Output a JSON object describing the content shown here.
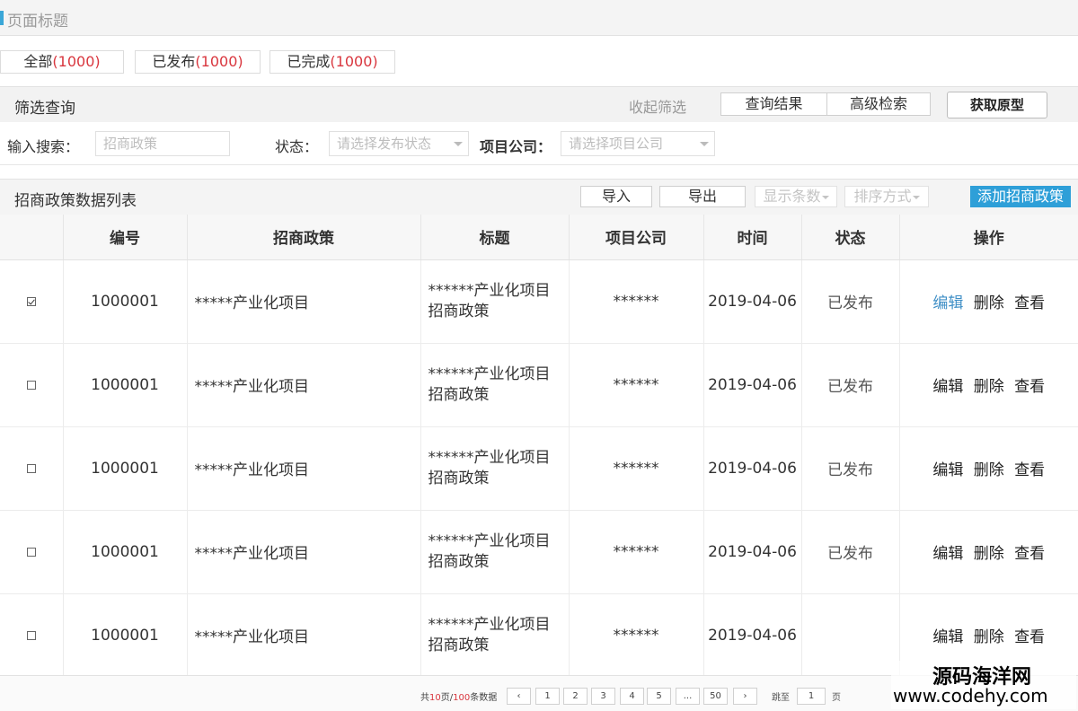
{
  "page": {
    "title": "页面标题"
  },
  "status_tabs": [
    {
      "label": "全部",
      "count": "(1000)"
    },
    {
      "label": "已发布",
      "count": "(1000)"
    },
    {
      "label": "已完成",
      "count": "(1000)"
    }
  ],
  "filter": {
    "title": "筛选查询",
    "collapse_label": "收起筛选",
    "query_result_label": "查询结果",
    "advanced_label": "高级检索",
    "prototype_label": "获取原型",
    "search_label": "输入搜索：",
    "search_placeholder": "招商政策",
    "status_label": "状态：",
    "status_placeholder": "请选择发布状态",
    "company_label": "项目公司：",
    "company_placeholder": "请选择项目公司"
  },
  "list": {
    "title": "招商政策数据列表",
    "import_label": "导入",
    "export_label": "导出",
    "display_count_label": "显示条数",
    "sort_label": "排序方式",
    "add_label": "添加招商政策"
  },
  "table": {
    "headers": [
      "",
      "编号",
      "招商政策",
      "标题",
      "项目公司",
      "时间",
      "状态",
      "操作"
    ],
    "actions": {
      "edit": "编辑",
      "delete": "删除",
      "view": "查看"
    },
    "rows": [
      {
        "checked": true,
        "id": "1000001",
        "policy": "*****产业化项目",
        "title": "******产业化项目招商政策",
        "company": "******",
        "date": "2019-04-06",
        "status": "已发布"
      },
      {
        "checked": false,
        "id": "1000001",
        "policy": "*****产业化项目",
        "title": "******产业化项目招商政策",
        "company": "******",
        "date": "2019-04-06",
        "status": "已发布"
      },
      {
        "checked": false,
        "id": "1000001",
        "policy": "*****产业化项目",
        "title": "******产业化项目招商政策",
        "company": "******",
        "date": "2019-04-06",
        "status": "已发布"
      },
      {
        "checked": false,
        "id": "1000001",
        "policy": "*****产业化项目",
        "title": "******产业化项目招商政策",
        "company": "******",
        "date": "2019-04-06",
        "status": "已发布"
      },
      {
        "checked": false,
        "id": "1000001",
        "policy": "*****产业化项目",
        "title": "******产业化项目招商政策",
        "company": "******",
        "date": "2019-04-06",
        "status": ""
      }
    ]
  },
  "pagination": {
    "summary_prefix": "共",
    "total_pages": "10",
    "summary_mid": "页/",
    "total_items": "100",
    "summary_suffix": "条数据",
    "prev": "‹",
    "pages": [
      "1",
      "2",
      "3",
      "4",
      "5",
      "...",
      "50"
    ],
    "next": "›",
    "jump_label": "跳至",
    "jump_value": "1",
    "page_unit": "页"
  },
  "watermark": {
    "name": "源码海洋网",
    "url": "www.codehy.com"
  },
  "colors": {
    "accent": "#2e9fd8",
    "count_red": "#d9363e",
    "edit_link": "#3f8fc6"
  }
}
